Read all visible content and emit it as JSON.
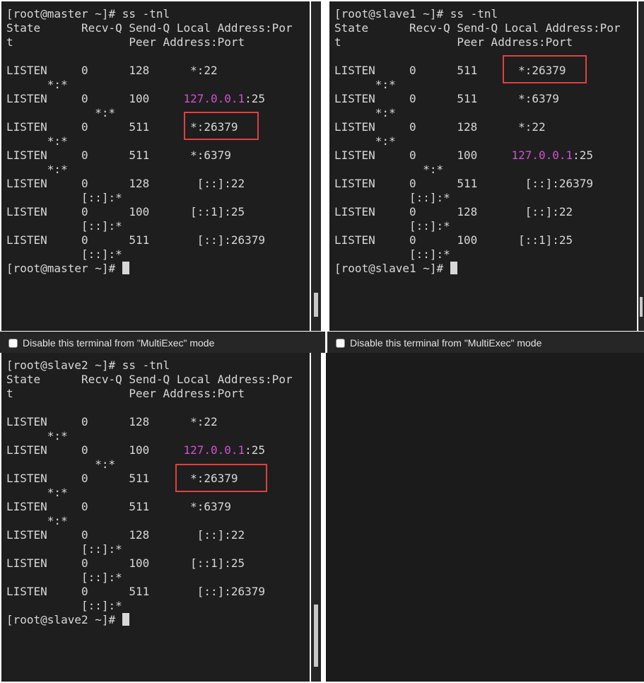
{
  "panes": [
    {
      "id": "master",
      "lines": [
        [
          {
            "t": "[root@master ~]# ss -tnl"
          }
        ],
        [
          {
            "t": "State      Recv-Q Send-Q Local Address:Por"
          }
        ],
        [
          {
            "t": "t                 Peer Address:Port"
          }
        ],
        [
          {
            "t": ""
          }
        ],
        [
          {
            "t": "LISTEN     0      128      *:22"
          }
        ],
        [
          {
            "t": "      *:*"
          }
        ],
        [
          {
            "t": "LISTEN     0      100     "
          },
          {
            "t": "127.0.0.1",
            "c": "magenta"
          },
          {
            "t": ":25"
          }
        ],
        [
          {
            "t": "             *:*"
          }
        ],
        [
          {
            "t": "LISTEN     0      511      *:26379"
          }
        ],
        [
          {
            "t": "      *:*"
          }
        ],
        [
          {
            "t": "LISTEN     0      511      *:6379"
          }
        ],
        [
          {
            "t": "      *:*"
          }
        ],
        [
          {
            "t": "LISTEN     0      128       [::]:22"
          }
        ],
        [
          {
            "t": "           [::]:*"
          }
        ],
        [
          {
            "t": "LISTEN     0      100      [::1]:25"
          }
        ],
        [
          {
            "t": "           [::]:*"
          }
        ],
        [
          {
            "t": "LISTEN     0      511       [::]:26379"
          }
        ],
        [
          {
            "t": "           [::]:*"
          }
        ],
        [
          {
            "t": "[root@master ~]# "
          },
          {
            "cursor": true
          }
        ]
      ]
    },
    {
      "id": "slave1",
      "lines": [
        [
          {
            "t": "[root@slave1 ~]# ss -tnl"
          }
        ],
        [
          {
            "t": "State      Recv-Q Send-Q Local Address:Por"
          }
        ],
        [
          {
            "t": "t                 Peer Address:Port"
          }
        ],
        [
          {
            "t": ""
          }
        ],
        [
          {
            "t": "LISTEN     0      511      *:26379"
          }
        ],
        [
          {
            "t": "      *:*"
          }
        ],
        [
          {
            "t": "LISTEN     0      511      *:6379"
          }
        ],
        [
          {
            "t": "      *:*"
          }
        ],
        [
          {
            "t": "LISTEN     0      128      *:22"
          }
        ],
        [
          {
            "t": "      *:*"
          }
        ],
        [
          {
            "t": "LISTEN     0      100     "
          },
          {
            "t": "127.0.0.1",
            "c": "magenta"
          },
          {
            "t": ":25"
          }
        ],
        [
          {
            "t": "             *:*"
          }
        ],
        [
          {
            "t": "LISTEN     0      511       [::]:26379"
          }
        ],
        [
          {
            "t": "           [::]:*"
          }
        ],
        [
          {
            "t": "LISTEN     0      128       [::]:22"
          }
        ],
        [
          {
            "t": "           [::]:*"
          }
        ],
        [
          {
            "t": "LISTEN     0      100      [::1]:25"
          }
        ],
        [
          {
            "t": "           [::]:*"
          }
        ],
        [
          {
            "t": "[root@slave1 ~]# "
          },
          {
            "cursor": true
          }
        ]
      ]
    },
    {
      "id": "slave2",
      "lines": [
        [
          {
            "t": "[root@slave2 ~]# ss -tnl"
          }
        ],
        [
          {
            "t": "State      Recv-Q Send-Q Local Address:Por"
          }
        ],
        [
          {
            "t": "t                 Peer Address:Port"
          }
        ],
        [
          {
            "t": ""
          }
        ],
        [
          {
            "t": "LISTEN     0      128      *:22"
          }
        ],
        [
          {
            "t": "      *:*"
          }
        ],
        [
          {
            "t": "LISTEN     0      100     "
          },
          {
            "t": "127.0.0.1",
            "c": "magenta"
          },
          {
            "t": ":25"
          }
        ],
        [
          {
            "t": "             *:*"
          }
        ],
        [
          {
            "t": "LISTEN     0      511      *:26379"
          }
        ],
        [
          {
            "t": "      *:*"
          }
        ],
        [
          {
            "t": "LISTEN     0      511      *:6379"
          }
        ],
        [
          {
            "t": "      *:*"
          }
        ],
        [
          {
            "t": "LISTEN     0      128       [::]:22"
          }
        ],
        [
          {
            "t": "           [::]:*"
          }
        ],
        [
          {
            "t": "LISTEN     0      100      [::1]:25"
          }
        ],
        [
          {
            "t": "           [::]:*"
          }
        ],
        [
          {
            "t": "LISTEN     0      511       [::]:26379"
          }
        ],
        [
          {
            "t": "           [::]:*"
          }
        ],
        [
          {
            "t": "[root@slave2 ~]# "
          },
          {
            "cursor": true
          }
        ]
      ]
    }
  ],
  "multiexec": {
    "master_label": "Disable this terminal from \"MultiExec\" mode",
    "slave1_label": "Disable this terminal from \"MultiExec\" mode"
  },
  "colors": {
    "terminal_bg": "#1e1e1e",
    "text": "#d8d8d8",
    "ip_highlight": "#d250d2",
    "annotation_box": "#e04040"
  },
  "icons": {
    "cursor": "block-cursor-icon",
    "checkbox": "checkbox-icon"
  }
}
